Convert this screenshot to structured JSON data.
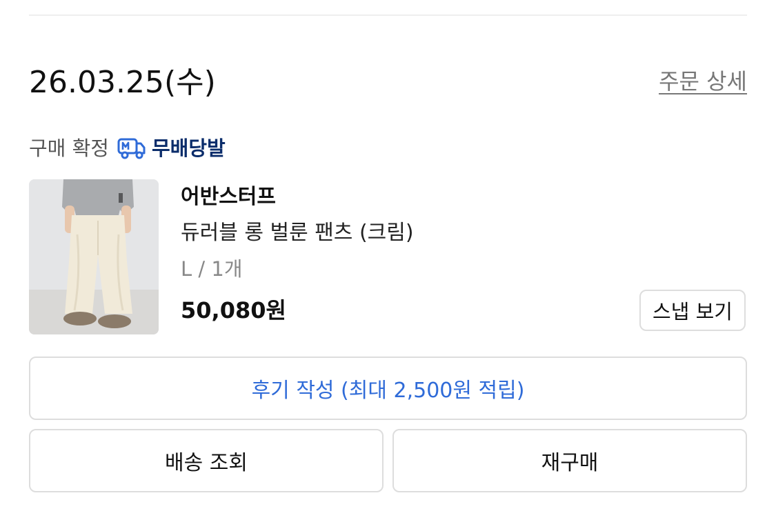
{
  "order": {
    "date": "26.03.25(수)",
    "detail_link": "주문 상세",
    "status": "구매 확정",
    "delivery_badge": {
      "icon": "truck-m-icon",
      "label": "무배당발",
      "color": "#0b2d6b"
    }
  },
  "product": {
    "image_icon": "product-photo-cream-pants",
    "brand": "어반스터프",
    "name": "듀러블 롱 벌룬 팬츠 (크림)",
    "option": "L / 1개",
    "price": "50,080원",
    "snap_button": "스냅 보기"
  },
  "actions": {
    "review": "후기 작성 (최대 2,500원 적립)",
    "track": "배송 조회",
    "rebuy": "재구매"
  },
  "colors": {
    "accent_blue": "#2f6bd8",
    "badge_navy": "#0b2d6b",
    "border": "#dddddd"
  }
}
